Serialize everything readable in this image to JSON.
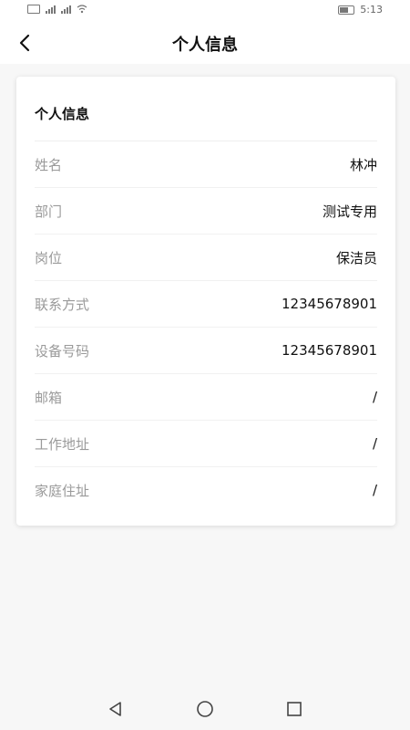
{
  "status_bar": {
    "time": "5:13",
    "icons": [
      "sim-icon",
      "signal-icon",
      "signal-icon",
      "wifi-icon",
      "battery-icon"
    ]
  },
  "header": {
    "title": "个人信息",
    "back_icon": "chevron-left-icon"
  },
  "card": {
    "title": "个人信息",
    "rows": [
      {
        "label": "姓名",
        "value": "林冲"
      },
      {
        "label": "部门",
        "value": "测试专用"
      },
      {
        "label": "岗位",
        "value": "保洁员"
      },
      {
        "label": "联系方式",
        "value": "12345678901"
      },
      {
        "label": "设备号码",
        "value": "12345678901"
      },
      {
        "label": "邮箱",
        "value": "/"
      },
      {
        "label": "工作地址",
        "value": "/"
      },
      {
        "label": "家庭住址",
        "value": "/"
      }
    ]
  },
  "nav_bar": {
    "buttons": [
      "back-triangle-icon",
      "home-circle-icon",
      "recents-square-icon"
    ]
  },
  "colors": {
    "background": "#f7f7f7",
    "card": "#ffffff",
    "label": "#9a9a9a",
    "value": "#111111"
  }
}
